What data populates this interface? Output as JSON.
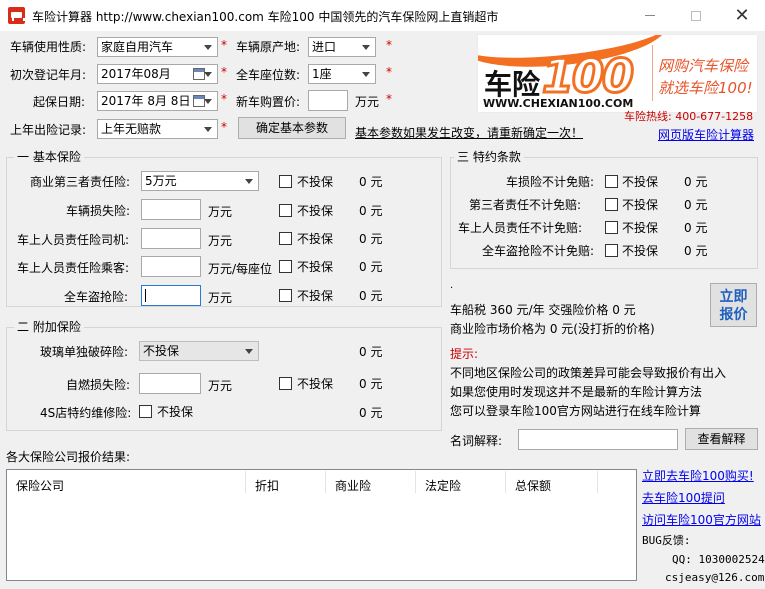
{
  "window": {
    "title": "车险计算器 http://www.chexian100.com 车险100 中国领先的汽车保险网上直销超市"
  },
  "basic_params": {
    "usage_label": "车辆使用性质:",
    "usage_value": "家庭自用汽车",
    "origin_label": "车辆原产地:",
    "origin_value": "进口",
    "reg_date_label": "初次登记年月:",
    "reg_date_value": "2017年08月",
    "seats_label": "全车座位数:",
    "seats_value": "1座",
    "start_date_label": "起保日期:",
    "start_date_value": "2017年  8月  8日",
    "new_price_label": "新车购置价:",
    "new_price_unit": "万元",
    "last_year_label": "上年出险记录:",
    "last_year_value": "上年无赔款",
    "confirm_button": "确定基本参数",
    "change_notice": "基本参数如果发生改变，请重新确定一次！",
    "required_mark": "*"
  },
  "logo": {
    "brand_cn": "车险",
    "brand_num": "100",
    "url": "WWW.CHEXIAN100.COM",
    "slogan1": "网购汽车保险",
    "slogan2": "就选车险100!"
  },
  "contact": {
    "hotline": "车险热线: 400-677-1258",
    "web_calc_link": "网页版车险计算器"
  },
  "basic_insurance": {
    "title": "一 基本保险",
    "third_party_label": "商业第三者责任险:",
    "third_party_value": "5万元",
    "vehicle_damage_label": "车辆损失险:",
    "driver_label": "车上人员责任险司机:",
    "passenger_label": "车上人员责任险乘客:",
    "theft_label": "全车盗抢险:",
    "unit_wan": "万元",
    "unit_per_seat": "万元/每座位",
    "not_insured": "不投保",
    "amount": "0 元"
  },
  "special_terms": {
    "title": "三 特约条款",
    "items": [
      {
        "label": "车损险不计免赔:",
        "not_insured": "不投保",
        "amount": "0 元"
      },
      {
        "label": "第三者责任不计免赔:",
        "not_insured": "不投保",
        "amount": "0 元"
      },
      {
        "label": "车上人员责任不计免赔:",
        "not_insured": "不投保",
        "amount": "0 元"
      },
      {
        "label": "全车盗抢险不计免赔:",
        "not_insured": "不投保",
        "amount": "0 元"
      }
    ]
  },
  "additional_insurance": {
    "title": "二 附加保险",
    "glass_label": "玻璃单独破碎险:",
    "glass_value": "不投保",
    "self_ignite_label": "自燃损失险:",
    "self_ignite_unit": "万元",
    "repair_label": "4S店特约维修险:",
    "not_insured": "不投保",
    "amount": "0 元"
  },
  "summary": {
    "dot": "·",
    "tax_line": "车船税 360 元/年   交强险价格 0 元",
    "market_price_line": "商业险市场价格为 0 元(没打折的价格)",
    "quote_button_line1": "立即",
    "quote_button_line2": "报价",
    "tip_title": "提示:",
    "tip_lines": [
      "不同地区保险公司的政策差异可能会导致报价有出入",
      "如果您使用时发现这并不是最新的车险计算方法",
      "您可以登录车险100官方网站进行在线车险计算"
    ]
  },
  "glossary": {
    "label": "名词解释:",
    "button": "查看解释"
  },
  "results": {
    "title": "各大保险公司报价结果:",
    "columns": [
      "保险公司",
      "折扣",
      "商业险",
      "法定险",
      "总保额"
    ]
  },
  "side_links": {
    "buy": "立即去车险100购买!",
    "ask": "去车险100提问",
    "visit": "访问车险100官方网站",
    "bug_label": "BUG反馈:",
    "qq": "QQ: 1030002524",
    "email": "csjeasy@126.com"
  }
}
